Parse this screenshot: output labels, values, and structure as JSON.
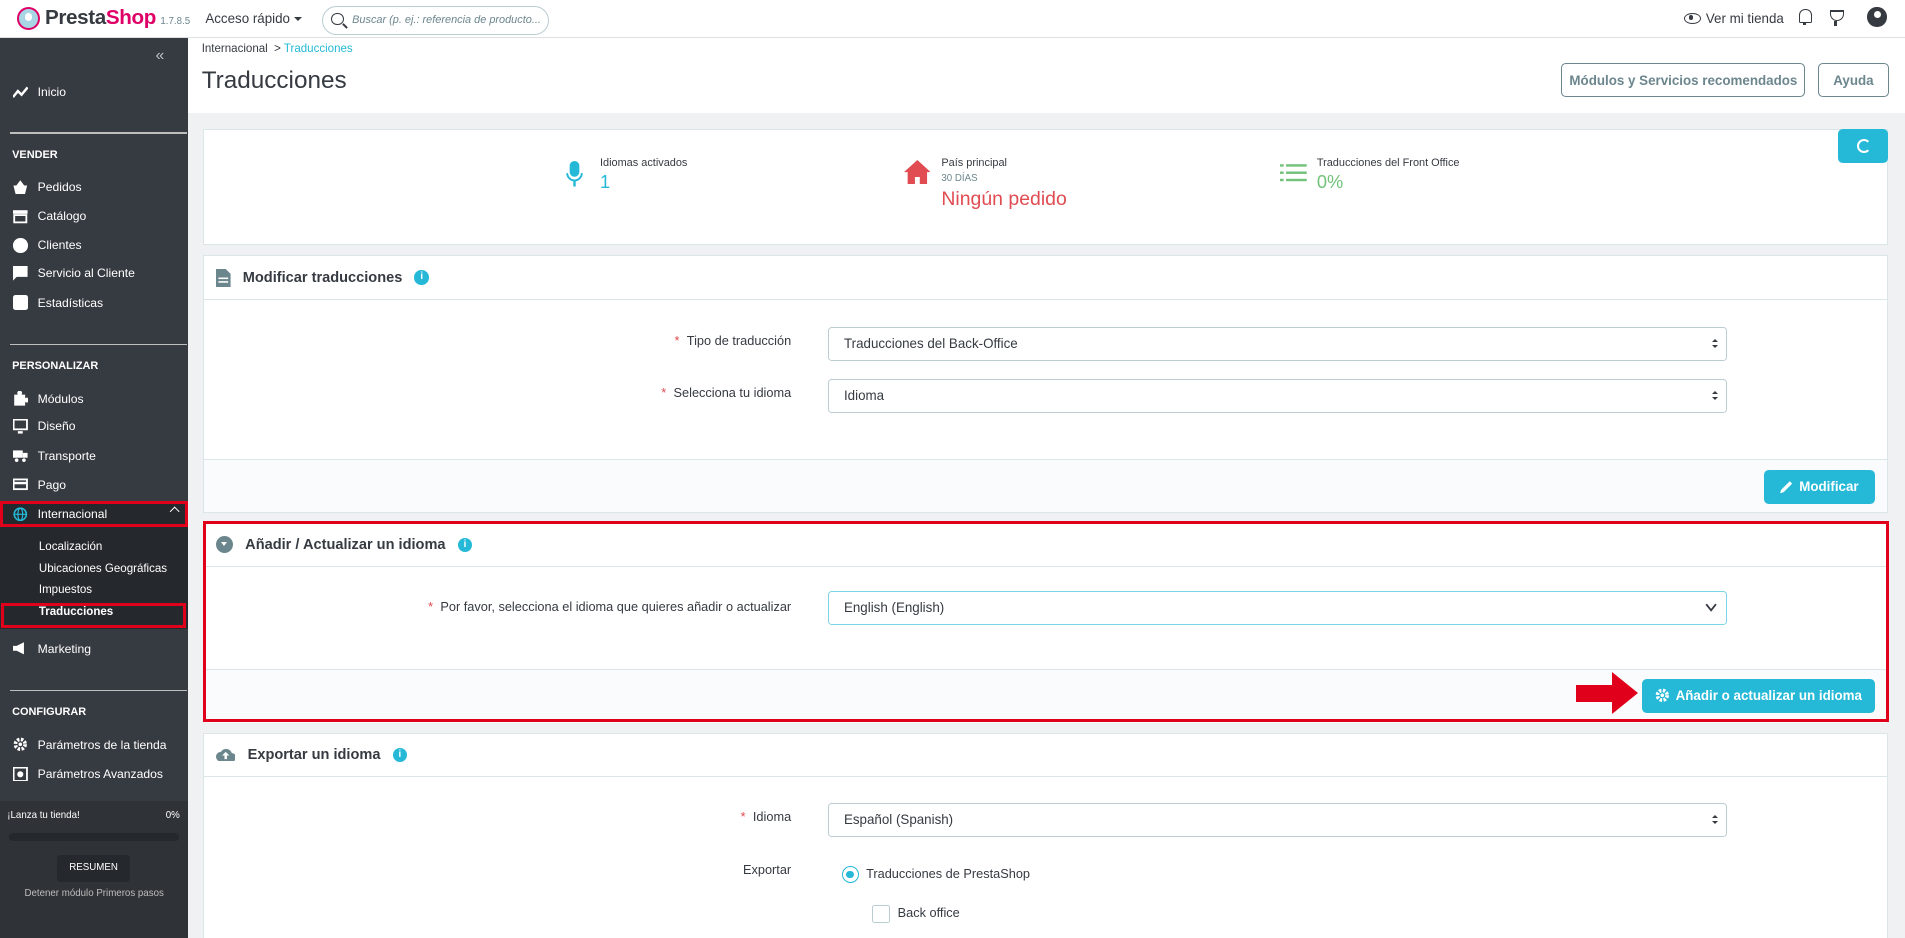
{
  "header": {
    "logo_a": "Presta",
    "logo_b": "Shop",
    "version": "1.7.8.5",
    "quick_access": "Acceso rápido",
    "search_placeholder": "Buscar (p. ej.: referencia de producto...",
    "view_shop": "Ver mi tienda"
  },
  "sidebar": {
    "home": "Inicio",
    "sec_sell": "VENDER",
    "sell": [
      "Pedidos",
      "Catálogo",
      "Clientes",
      "Servicio al Cliente",
      "Estadísticas"
    ],
    "sec_custom": "PERSONALIZAR",
    "custom": [
      "Módulos",
      "Diseño",
      "Transporte",
      "Pago"
    ],
    "active": "Internacional",
    "subs": [
      "Localización",
      "Ubicaciones Geográficas",
      "Impuestos",
      "Traducciones"
    ],
    "marketing": "Marketing",
    "sec_config": "CONFIGURAR",
    "config": [
      "Parámetros de la tienda",
      "Parámetros Avanzados"
    ],
    "launch": "¡Lanza tu tienda!",
    "launch_pct": "0%",
    "launch_progress": 0,
    "resumen": "RESUMEN",
    "stop": "Detener módulo Primeros pasos"
  },
  "breadcrumb": {
    "parent": "Internacional",
    "sep": ">",
    "current": "Traducciones"
  },
  "page": {
    "title": "Traducciones",
    "btn_modules": "Módulos y Servicios recomendados",
    "btn_help": "Ayuda"
  },
  "kpi": {
    "languages_label": "Idiomas activados",
    "languages_value": "1",
    "country_label": "País principal",
    "country_sub": "30 DÍAS",
    "country_value": "Ningún pedido",
    "front_label": "Traducciones del Front Office",
    "front_value": "0%",
    "colors": {
      "blue": "#25b9d7",
      "red": "#e04c52",
      "green": "#72c279"
    }
  },
  "modify": {
    "title": "Modificar traducciones",
    "type_label": "Tipo de traducción",
    "type_value": "Traducciones del Back-Office",
    "lang_label": "Selecciona tu idioma",
    "lang_value": "Idioma",
    "button": "Modificar"
  },
  "add": {
    "title": "Añadir / Actualizar un idioma",
    "label": "Por favor, selecciona el idioma que quieres añadir o actualizar",
    "value": "English (English)",
    "button": "Añadir o actualizar un idioma"
  },
  "export": {
    "title": "Exportar un idioma",
    "lang_label": "Idioma",
    "lang_value": "Español (Spanish)",
    "export_label": "Exportar",
    "radio": "Traducciones de PrestaShop",
    "check": "Back office"
  },
  "required_mark": "*",
  "info_mark": "i"
}
